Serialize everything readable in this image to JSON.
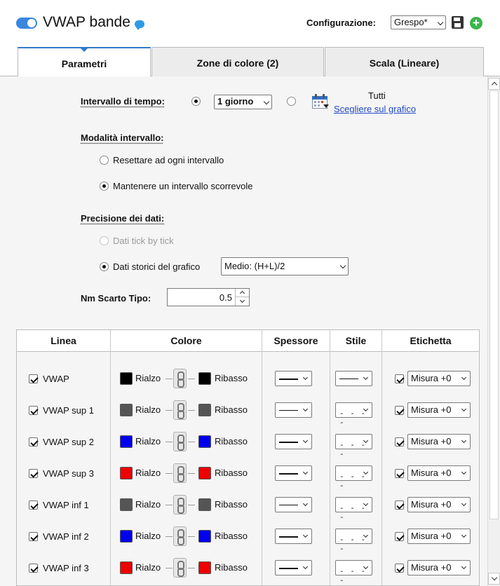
{
  "header": {
    "title": "VWAP bande",
    "config_label": "Configurazione:",
    "config_value": "Grespo*",
    "icons": {
      "toggle": "toggle-on",
      "info": "speech-bubble-icon",
      "save": "floppy-disk-icon",
      "add": "plus-circle-icon"
    },
    "add_glyph": "+"
  },
  "tabs": [
    {
      "label": "Parametri",
      "active": true
    },
    {
      "label": "Zone di colore (2)",
      "active": false
    },
    {
      "label": "Scala (Lineare)",
      "active": false
    }
  ],
  "params": {
    "interval_label": "Intervallo di tempo:",
    "interval_value": "1 giorno",
    "all_label": "Tutti",
    "choose_link": "Scegliere sul grafico",
    "mode_label": "Modalità intervallo:",
    "mode_reset": "Resettare ad ogni intervallo",
    "mode_keep": "Mantenere un intervallo scorrevole",
    "precision_label": "Precisione dei dati:",
    "precision_tick": "Dati tick by tick",
    "precision_hist": "Dati storici del grafico",
    "precision_value": "Medio: (H+L)/2",
    "std_label": "Nm Scarto Tipo:",
    "std_value": "0.5"
  },
  "table": {
    "headers": {
      "linea": "Linea",
      "colore": "Colore",
      "spessore": "Spessore",
      "stile": "Stile",
      "etichetta": "Etichetta"
    },
    "up_label": "Rialzo",
    "down_label": "Ribasso",
    "rows": [
      {
        "name": "VWAP",
        "color": "#000000",
        "style": "solid",
        "label": "Misura +0"
      },
      {
        "name": "VWAP sup 1",
        "color": "#555555",
        "style": "dashed",
        "label": "Misura +0"
      },
      {
        "name": "VWAP sup 2",
        "color": "#0000ee",
        "style": "dashed",
        "label": "Misura +0"
      },
      {
        "name": "VWAP sup 3",
        "color": "#ee0000",
        "style": "dashed",
        "label": "Misura +0"
      },
      {
        "name": "VWAP inf 1",
        "color": "#555555",
        "style": "dashed",
        "label": "Misura +0"
      },
      {
        "name": "VWAP inf 2",
        "color": "#0000ee",
        "style": "dashed",
        "label": "Misura +0"
      },
      {
        "name": "VWAP inf 3",
        "color": "#ee0000",
        "style": "dashed",
        "label": "Misura +0"
      }
    ],
    "dashed_glyph": "- - - -",
    "colors": {
      "accent": "#2f79c9",
      "toggle": "#3a87e0",
      "add": "#3bb54a"
    }
  }
}
